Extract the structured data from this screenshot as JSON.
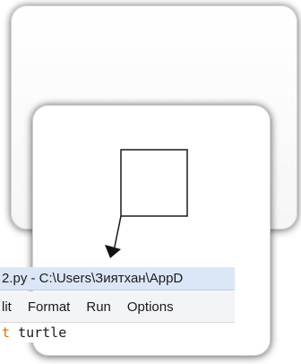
{
  "editor": {
    "title": "2.py - C:\\Users\\Зиятхан\\AppD",
    "menu": [
      "lit",
      "Format",
      "Run",
      "Options"
    ],
    "code": {
      "keyword": "t",
      "text": "turtle"
    }
  },
  "colors": {
    "title_bar": "#dbe7f7",
    "menu_bar": "#f3f4f6",
    "keyword": "#e07000",
    "turtle_line": "#000000"
  },
  "icons": {
    "turtle_cursor": "arrow-turtle-icon"
  }
}
